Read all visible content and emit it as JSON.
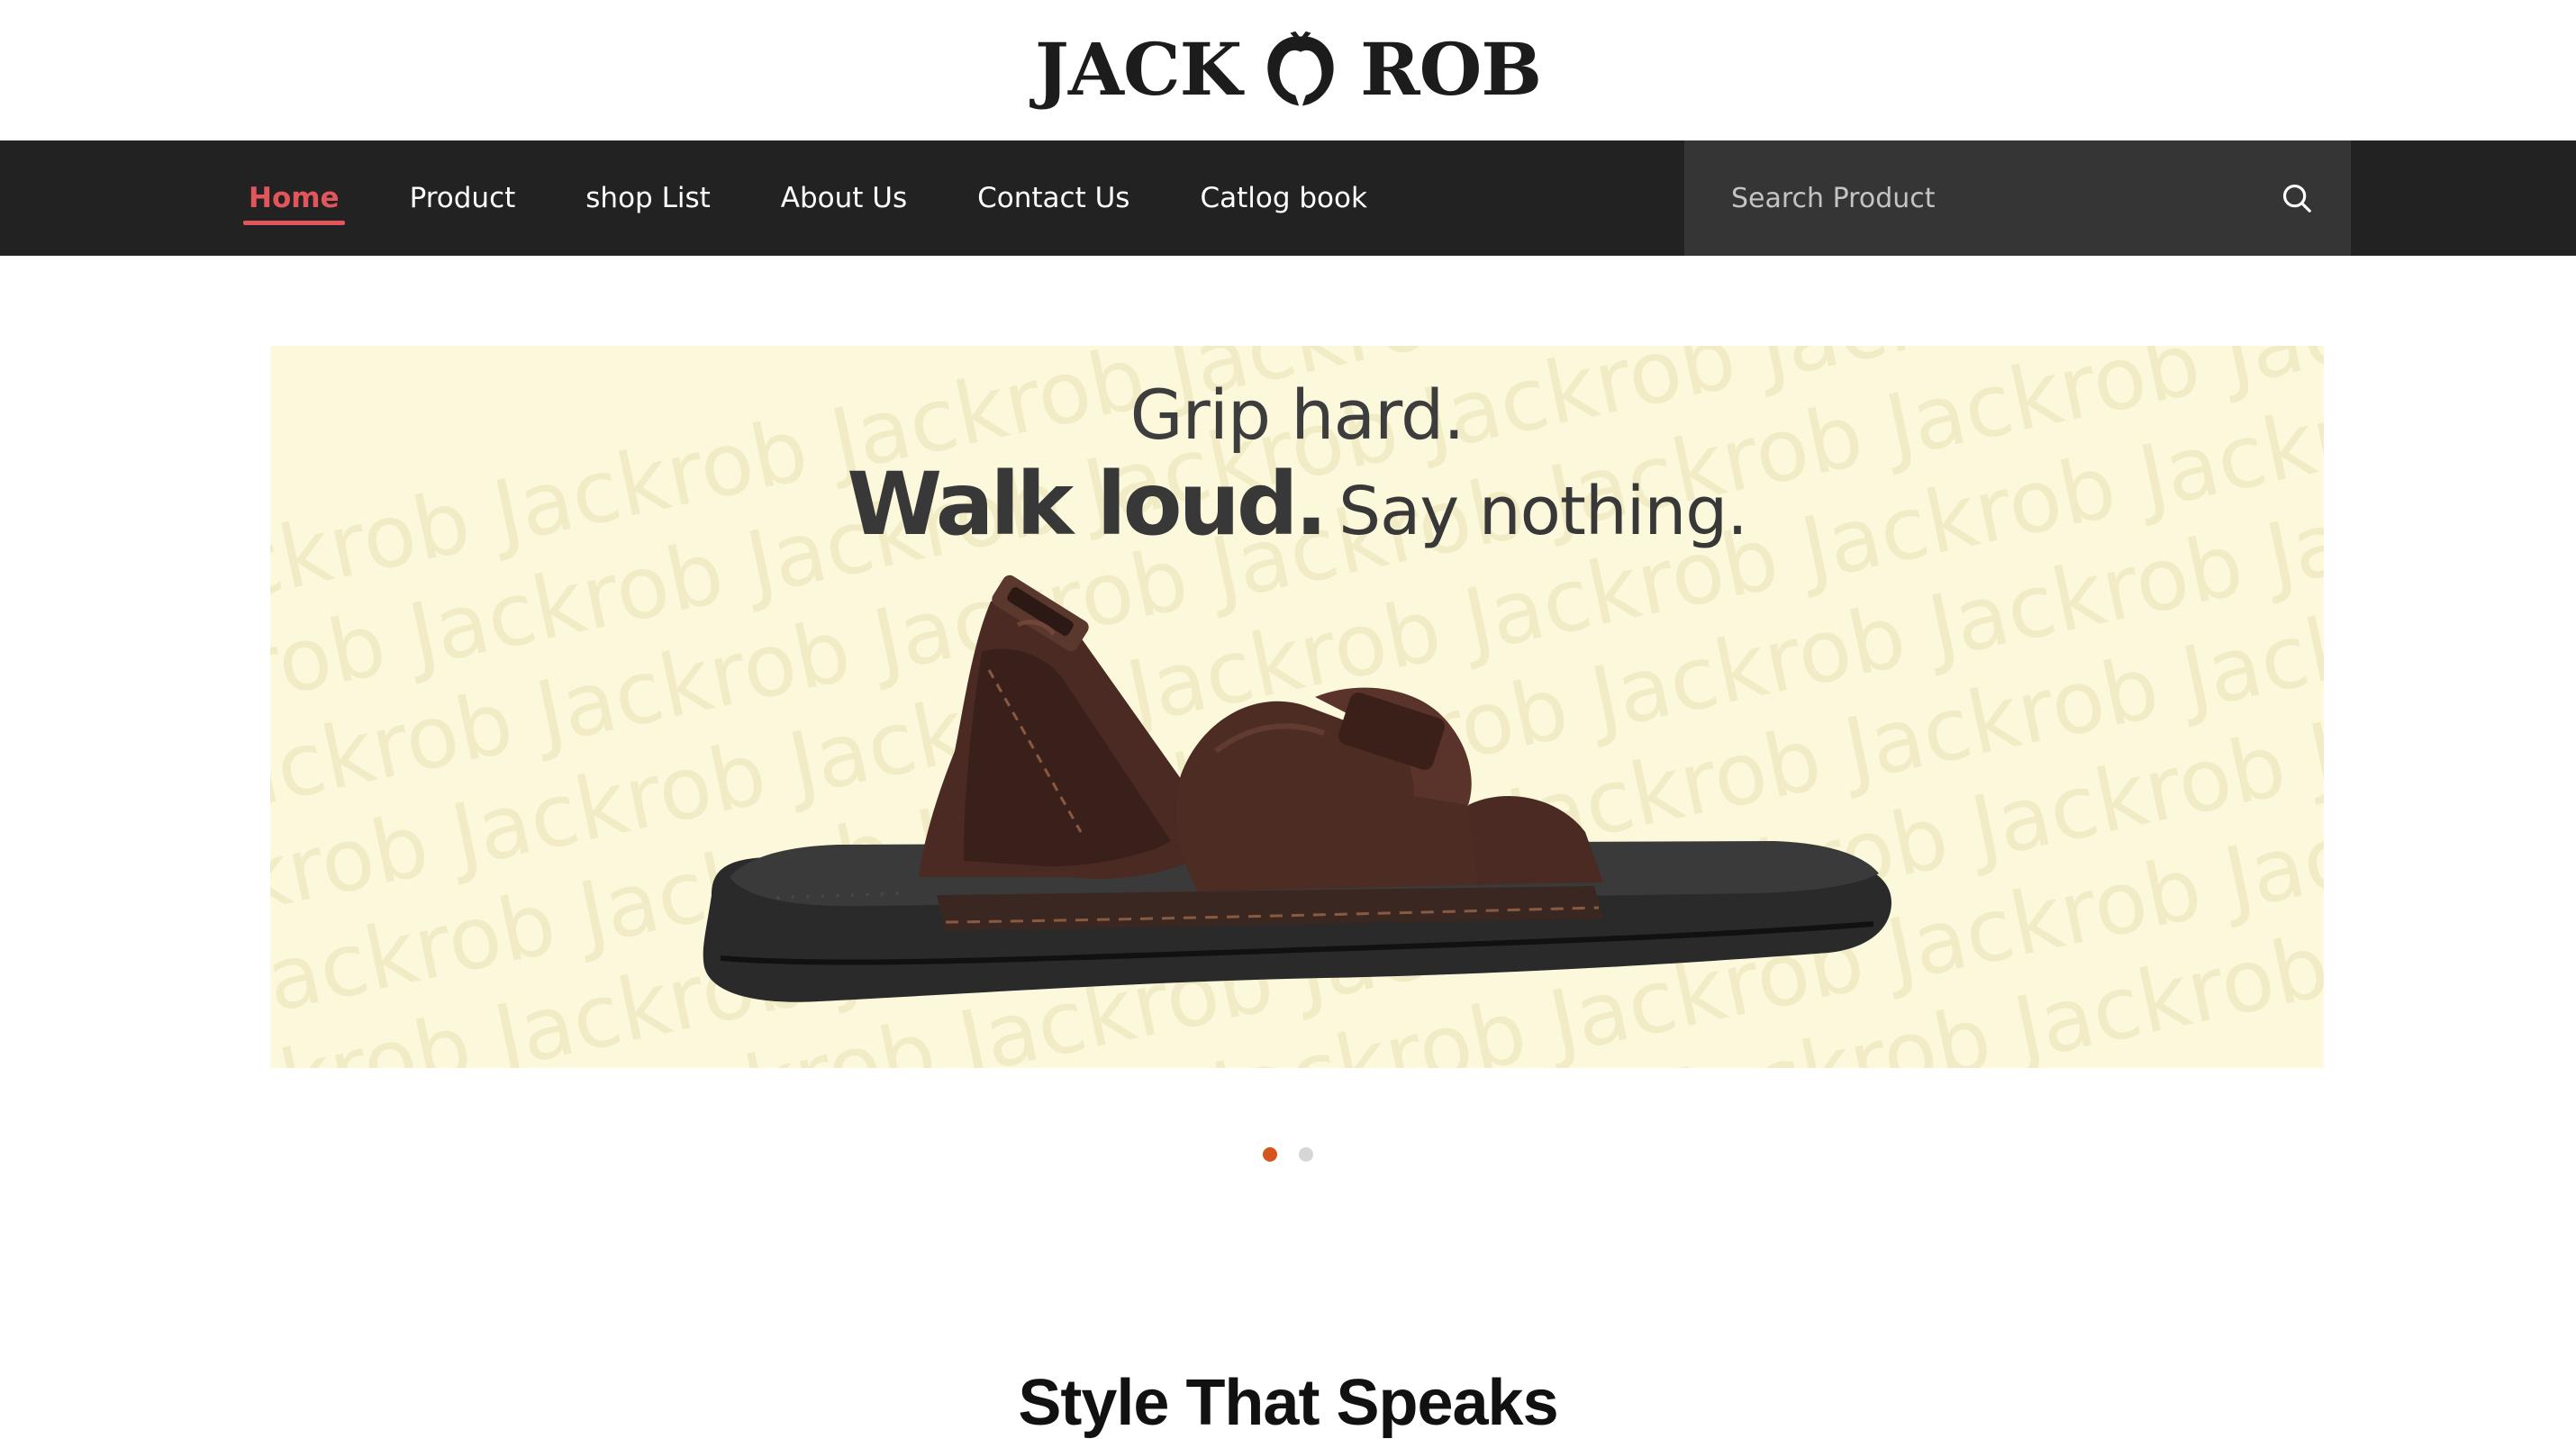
{
  "brand": {
    "name_left": "JACK",
    "name_right": "ROB",
    "logo_icon": "stylized-round-monogram"
  },
  "nav": {
    "items": [
      {
        "label": "Home",
        "active": true
      },
      {
        "label": "Product",
        "active": false
      },
      {
        "label": "shop List",
        "active": false
      },
      {
        "label": "About Us",
        "active": false
      },
      {
        "label": "Contact Us",
        "active": false
      },
      {
        "label": "Catlog book",
        "active": false
      }
    ]
  },
  "search": {
    "placeholder": "Search Product",
    "value": "",
    "icon": "search-icon"
  },
  "hero": {
    "headline_1": "Grip hard.",
    "headline_2_bold": "Walk loud.",
    "headline_2_light": "Say nothing.",
    "watermark_text": "Jackrob",
    "image": "brown leather strap sandal with velcro",
    "background_color": "#fbf8dc"
  },
  "carousel": {
    "slides": 2,
    "active_index": 0
  },
  "section": {
    "title": "Style That Speaks"
  },
  "colors": {
    "accent_red": "#e2555a",
    "dot_active": "#d3561f",
    "navbar_bg": "#222222",
    "search_bg": "#353535"
  }
}
